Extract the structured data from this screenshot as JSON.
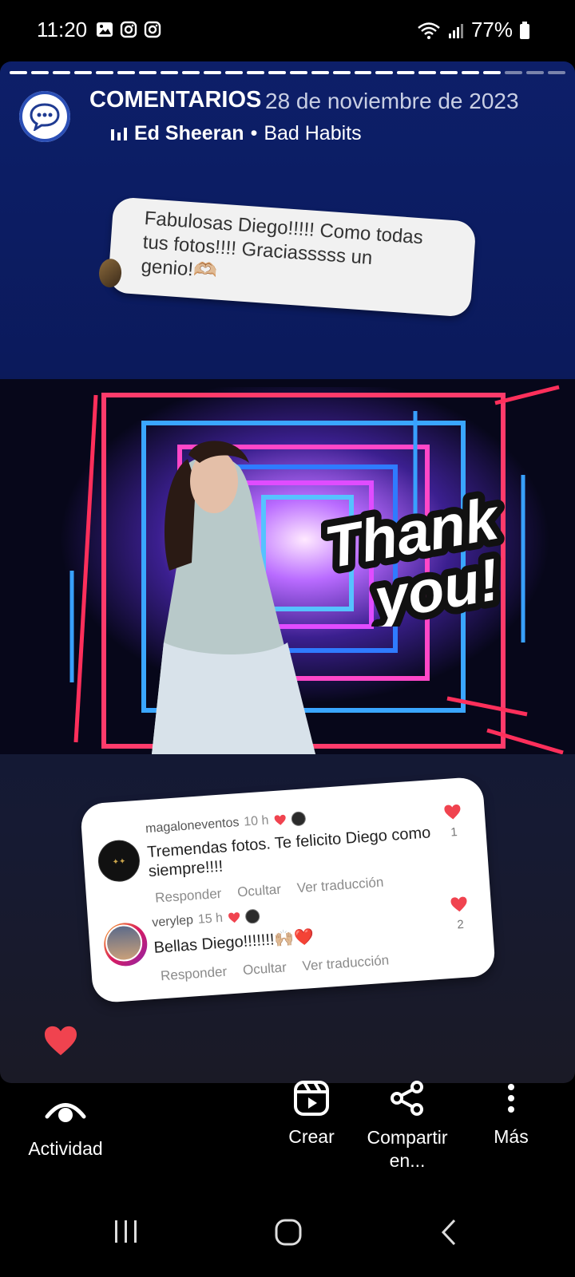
{
  "status_bar": {
    "time": "11:20",
    "battery": "77%"
  },
  "story": {
    "header": {
      "title": "COMENTARIOS",
      "date": "28 de noviembre de 2023",
      "artist": "Ed Sheeran",
      "song": "Bad Habits"
    },
    "bubble_text": "Fabulosas Diego!!!!! Como todas tus fotos!!!! Graciasssss un genio!🫶🏼",
    "comments": [
      {
        "username": "magaloneventos",
        "time": "10 h",
        "text": "Tremendas fotos. Te felicito Diego como siempre!!!!",
        "likes": "1",
        "actions": [
          "Responder",
          "Ocultar",
          "Ver traducción"
        ]
      },
      {
        "username": "verylep",
        "time": "15 h",
        "text": "Bellas Diego!!!!!!!🙌🏼❤️",
        "likes": "2",
        "actions": [
          "Responder",
          "Ocultar",
          "Ver traducción"
        ]
      }
    ]
  },
  "actions": {
    "activity": "Actividad",
    "create": "Crear",
    "share": "Compartir en...",
    "more": "Más"
  },
  "colors": {
    "heart": "#f0434f",
    "story_top": "#0d1f69",
    "accent": "#2b4fb6"
  }
}
